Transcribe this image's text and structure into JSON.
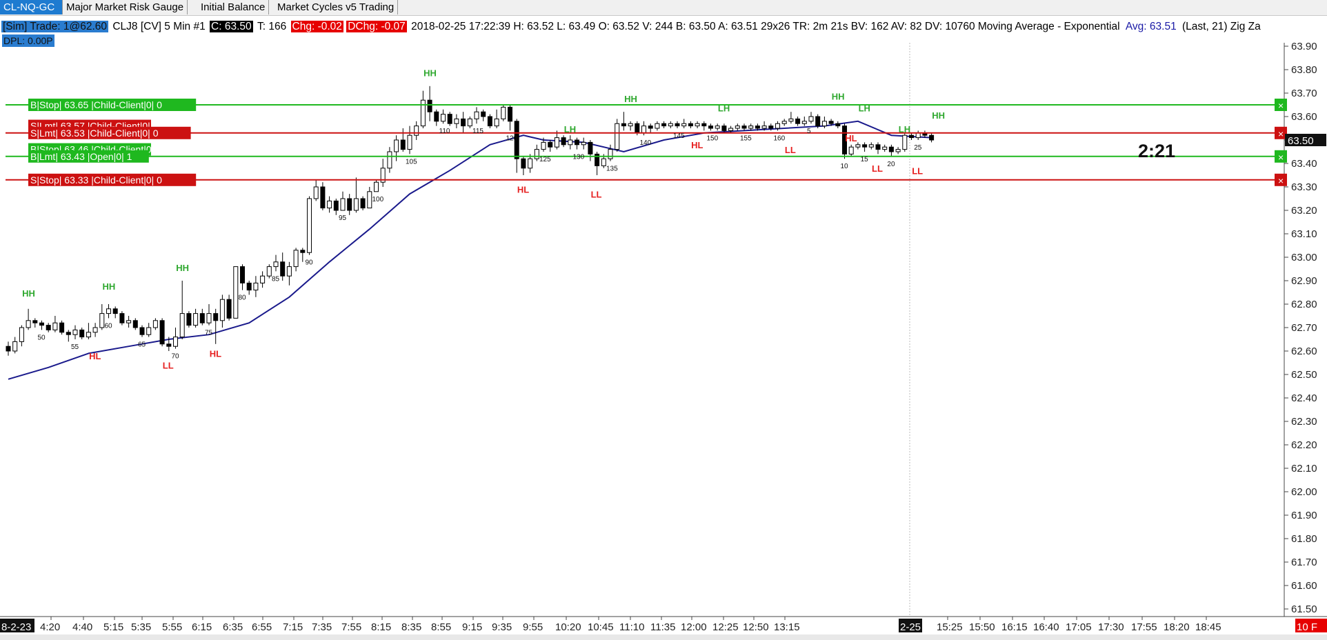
{
  "tabs": [
    {
      "label": "CL-NQ-GC",
      "active": true
    },
    {
      "label": "Major Market Risk Gauge",
      "active": false
    },
    {
      "label": "Initial Balance",
      "active": false
    },
    {
      "label": "Market Cycles v5 Trading",
      "active": false
    }
  ],
  "info": {
    "sim": "[Sim]  Trade: 1@62.60",
    "symbol": "CLJ8 [CV]  5 Min  #1",
    "close": "C: 63.50",
    "ticks": "T: 166",
    "chg": "Chg: -0.02",
    "dchg": "DChg: -0.07",
    "stats": "2018-02-25 17:22:39 H: 63.52 L: 63.49 O: 63.52 V: 244 B: 63.50 A: 63.51 29x26 TR: 2m 21s BV: 162 AV: 82 DV: 10760 Moving Average - Exponential",
    "avg": "Avg: 63.51",
    "last": "(Last, 21)  Zig Za",
    "dpl": "DPL: 0.00P"
  },
  "timer": "2:21",
  "chart_data": {
    "type": "candlestick",
    "symbol": "CLJ8",
    "interval": "5 Min",
    "ylim": [
      61.5,
      63.95
    ],
    "y_ticks": [
      "63.90",
      "63.80",
      "63.70",
      "63.60",
      "63.50",
      "63.40",
      "63.30",
      "63.20",
      "63.10",
      "63.00",
      "62.90",
      "62.80",
      "62.70",
      "62.60",
      "62.50",
      "62.40",
      "62.30",
      "62.20",
      "62.10",
      "62.00",
      "61.90",
      "61.80",
      "61.70",
      "61.60",
      "61.50"
    ],
    "x_ticks": [
      "8-2-23",
      "4:20",
      "4:40",
      "5:15",
      "5:35",
      "5:55",
      "6:15",
      "6:35",
      "6:55",
      "7:15",
      "7:35",
      "7:55",
      "8:15",
      "8:35",
      "8:55",
      "9:15",
      "9:35",
      "9:55",
      "10:20",
      "10:45",
      "11:10",
      "11:35",
      "12:00",
      "12:25",
      "12:50",
      "13:15",
      "2-25",
      "15:25",
      "15:50",
      "16:15",
      "16:40",
      "17:05",
      "17:30",
      "17:55",
      "18:20",
      "18:45",
      "10 F"
    ],
    "last_price_label": "63.50",
    "candles": [
      [
        62.62,
        62.6,
        62.64,
        62.58
      ],
      [
        62.6,
        62.64,
        62.66,
        62.59
      ],
      [
        62.64,
        62.7,
        62.71,
        62.62
      ],
      [
        62.7,
        62.73,
        62.78,
        62.69
      ],
      [
        62.73,
        62.72,
        62.74,
        62.7
      ],
      [
        62.72,
        62.71,
        62.73,
        62.69
      ],
      [
        62.71,
        62.69,
        62.72,
        62.68
      ],
      [
        62.69,
        62.72,
        62.75,
        62.68
      ],
      [
        62.72,
        62.68,
        62.73,
        62.67
      ],
      [
        62.68,
        62.67,
        62.69,
        62.64
      ],
      [
        62.67,
        62.69,
        62.71,
        62.65
      ],
      [
        62.69,
        62.66,
        62.7,
        62.65
      ],
      [
        62.66,
        62.68,
        62.72,
        62.65
      ],
      [
        62.68,
        62.7,
        62.72,
        62.66
      ],
      [
        62.7,
        62.76,
        62.8,
        62.69
      ],
      [
        62.76,
        62.78,
        62.8,
        62.74
      ],
      [
        62.78,
        62.76,
        62.79,
        62.74
      ],
      [
        62.76,
        62.72,
        62.77,
        62.71
      ],
      [
        62.72,
        62.73,
        62.75,
        62.7
      ],
      [
        62.73,
        62.7,
        62.74,
        62.69
      ],
      [
        62.7,
        62.67,
        62.71,
        62.66
      ],
      [
        62.67,
        62.7,
        62.72,
        62.66
      ],
      [
        62.7,
        62.73,
        62.74,
        62.69
      ],
      [
        62.73,
        62.63,
        62.74,
        62.62
      ],
      [
        62.63,
        62.62,
        62.66,
        62.6
      ],
      [
        62.62,
        62.66,
        62.7,
        62.61
      ],
      [
        62.66,
        62.76,
        62.9,
        62.65
      ],
      [
        62.76,
        62.71,
        62.77,
        62.7
      ],
      [
        62.71,
        62.76,
        62.78,
        62.7
      ],
      [
        62.76,
        62.72,
        62.78,
        62.71
      ],
      [
        62.72,
        62.76,
        62.8,
        62.71
      ],
      [
        62.76,
        62.73,
        62.78,
        62.63
      ],
      [
        62.73,
        62.82,
        62.84,
        62.7
      ],
      [
        62.82,
        62.74,
        62.84,
        62.73
      ],
      [
        62.74,
        62.96,
        62.96,
        62.74
      ],
      [
        62.96,
        62.89,
        62.97,
        62.86
      ],
      [
        62.89,
        62.86,
        62.9,
        62.84
      ],
      [
        62.86,
        62.89,
        62.92,
        62.83
      ],
      [
        62.89,
        62.92,
        62.94,
        62.87
      ],
      [
        62.92,
        62.96,
        62.97,
        62.91
      ],
      [
        62.96,
        62.98,
        63.01,
        62.94
      ],
      [
        62.98,
        62.92,
        63.02,
        62.9
      ],
      [
        62.92,
        62.96,
        62.98,
        62.88
      ],
      [
        62.96,
        63.03,
        63.04,
        62.94
      ],
      [
        63.03,
        63.02,
        63.04,
        62.98
      ],
      [
        63.02,
        63.25,
        63.26,
        63.01
      ],
      [
        63.25,
        63.3,
        63.33,
        63.24
      ],
      [
        63.3,
        63.21,
        63.32,
        63.2
      ],
      [
        63.21,
        63.24,
        63.26,
        63.19
      ],
      [
        63.24,
        63.2,
        63.25,
        63.18
      ],
      [
        63.2,
        63.25,
        63.28,
        63.2
      ],
      [
        63.25,
        63.2,
        63.27,
        63.18
      ],
      [
        63.2,
        63.25,
        63.34,
        63.19
      ],
      [
        63.25,
        63.21,
        63.26,
        63.2
      ],
      [
        63.21,
        63.28,
        63.3,
        63.21
      ],
      [
        63.28,
        63.32,
        63.33,
        63.28
      ],
      [
        63.32,
        63.38,
        63.42,
        63.3
      ],
      [
        63.38,
        63.45,
        63.47,
        63.36
      ],
      [
        63.45,
        63.5,
        63.52,
        63.41
      ],
      [
        63.5,
        63.46,
        63.55,
        63.45
      ],
      [
        63.46,
        63.52,
        63.56,
        63.44
      ],
      [
        63.52,
        63.56,
        63.58,
        63.5
      ],
      [
        63.56,
        63.67,
        63.71,
        63.55
      ],
      [
        63.67,
        63.62,
        63.73,
        63.58
      ],
      [
        63.62,
        63.58,
        63.63,
        63.56
      ],
      [
        63.58,
        63.61,
        63.63,
        63.57
      ],
      [
        63.61,
        63.57,
        63.62,
        63.56
      ],
      [
        63.57,
        63.59,
        63.61,
        63.55
      ],
      [
        63.59,
        63.56,
        63.62,
        63.53
      ],
      [
        63.56,
        63.59,
        63.6,
        63.55
      ],
      [
        63.59,
        63.62,
        63.64,
        63.57
      ],
      [
        63.62,
        63.6,
        63.63,
        63.58
      ],
      [
        63.6,
        63.56,
        63.61,
        63.55
      ],
      [
        63.56,
        63.59,
        63.63,
        63.55
      ],
      [
        63.59,
        63.64,
        63.65,
        63.58
      ],
      [
        63.64,
        63.58,
        63.65,
        63.54
      ],
      [
        63.58,
        63.42,
        63.59,
        63.36
      ],
      [
        63.42,
        63.38,
        63.43,
        63.35
      ],
      [
        63.38,
        63.42,
        63.44,
        63.36
      ],
      [
        63.42,
        63.46,
        63.48,
        63.41
      ],
      [
        63.46,
        63.49,
        63.51,
        63.45
      ],
      [
        63.49,
        63.47,
        63.5,
        63.45
      ],
      [
        63.47,
        63.51,
        63.54,
        63.46
      ],
      [
        63.51,
        63.48,
        63.52,
        63.47
      ],
      [
        63.48,
        63.5,
        63.52,
        63.46
      ],
      [
        63.5,
        63.48,
        63.51,
        63.46
      ],
      [
        63.48,
        63.49,
        63.51,
        63.46
      ],
      [
        63.49,
        63.44,
        63.5,
        63.41
      ],
      [
        63.44,
        63.39,
        63.45,
        63.35
      ],
      [
        63.39,
        63.42,
        63.44,
        63.38
      ],
      [
        63.42,
        63.46,
        63.48,
        63.41
      ],
      [
        63.46,
        63.57,
        63.59,
        63.45
      ],
      [
        63.57,
        63.56,
        63.62,
        63.54
      ],
      [
        63.56,
        63.57,
        63.58,
        63.54
      ],
      [
        63.57,
        63.53,
        63.58,
        63.52
      ],
      [
        63.53,
        63.56,
        63.58,
        63.52
      ],
      [
        63.56,
        63.55,
        63.57,
        63.53
      ],
      [
        63.55,
        63.57,
        63.58,
        63.54
      ],
      [
        63.57,
        63.56,
        63.58,
        63.55
      ],
      [
        63.56,
        63.57,
        63.58,
        63.55
      ],
      [
        63.57,
        63.56,
        63.58,
        63.55
      ],
      [
        63.56,
        63.57,
        63.59,
        63.55
      ],
      [
        63.57,
        63.56,
        63.58,
        63.55
      ],
      [
        63.56,
        63.57,
        63.58,
        63.55
      ],
      [
        63.57,
        63.56,
        63.58,
        63.54
      ],
      [
        63.56,
        63.55,
        63.57,
        63.54
      ],
      [
        63.55,
        63.56,
        63.57,
        63.54
      ],
      [
        63.56,
        63.54,
        63.57,
        63.53
      ],
      [
        63.54,
        63.55,
        63.56,
        63.53
      ],
      [
        63.55,
        63.56,
        63.57,
        63.54
      ],
      [
        63.56,
        63.55,
        63.57,
        63.54
      ],
      [
        63.55,
        63.56,
        63.57,
        63.54
      ],
      [
        63.56,
        63.55,
        63.57,
        63.54
      ],
      [
        63.55,
        63.56,
        63.58,
        63.54
      ],
      [
        63.56,
        63.55,
        63.57,
        63.54
      ],
      [
        63.55,
        63.57,
        63.58,
        63.54
      ],
      [
        63.57,
        63.58,
        63.59,
        63.56
      ],
      [
        63.58,
        63.59,
        63.62,
        63.57
      ],
      [
        63.59,
        63.57,
        63.6,
        63.56
      ],
      [
        63.57,
        63.58,
        63.6,
        63.56
      ],
      [
        63.58,
        63.6,
        63.62,
        63.57
      ],
      [
        63.6,
        63.56,
        63.61,
        63.55
      ],
      [
        63.56,
        63.58,
        63.6,
        63.55
      ],
      [
        63.58,
        63.57,
        63.59,
        63.56
      ],
      [
        63.57,
        63.56,
        63.58,
        63.55
      ],
      [
        63.56,
        63.44,
        63.57,
        63.42
      ],
      [
        63.44,
        63.47,
        63.48,
        63.43
      ],
      [
        63.47,
        63.48,
        63.49,
        63.46
      ],
      [
        63.48,
        63.47,
        63.49,
        63.45
      ],
      [
        63.47,
        63.48,
        63.49,
        63.46
      ],
      [
        63.48,
        63.46,
        63.49,
        63.44
      ],
      [
        63.46,
        63.47,
        63.48,
        63.45
      ],
      [
        63.47,
        63.45,
        63.48,
        63.43
      ],
      [
        63.45,
        63.46,
        63.47,
        63.44
      ],
      [
        63.46,
        63.52,
        63.53,
        63.45
      ],
      [
        63.52,
        63.51,
        63.53,
        63.5
      ],
      [
        63.51,
        63.53,
        63.54,
        63.5
      ],
      [
        63.53,
        63.52,
        63.54,
        63.51
      ],
      [
        63.52,
        63.5,
        63.53,
        63.49
      ]
    ],
    "ema": [
      [
        0,
        62.48
      ],
      [
        6,
        62.53
      ],
      [
        12,
        62.59
      ],
      [
        18,
        62.62
      ],
      [
        24,
        62.65
      ],
      [
        30,
        62.67
      ],
      [
        36,
        62.72
      ],
      [
        42,
        62.83
      ],
      [
        48,
        62.98
      ],
      [
        54,
        63.12
      ],
      [
        60,
        63.27
      ],
      [
        66,
        63.37
      ],
      [
        72,
        63.48
      ],
      [
        77,
        63.52
      ],
      [
        80,
        63.5
      ],
      [
        86,
        63.49
      ],
      [
        92,
        63.45
      ],
      [
        98,
        63.5
      ],
      [
        104,
        63.53
      ],
      [
        110,
        63.54
      ],
      [
        116,
        63.55
      ],
      [
        122,
        63.56
      ],
      [
        127,
        63.58
      ],
      [
        132,
        63.52
      ],
      [
        138,
        63.51
      ]
    ],
    "swings": [
      {
        "text": "HH",
        "price": 62.82,
        "i": 3,
        "kind": "high",
        "color": "#2fa82f"
      },
      {
        "text": "HH",
        "price": 62.85,
        "i": 15,
        "kind": "high",
        "color": "#2fa82f"
      },
      {
        "text": "HL",
        "price": 62.6,
        "i": 13,
        "kind": "low",
        "color": "#e62020"
      },
      {
        "text": "HH",
        "price": 62.93,
        "i": 26,
        "kind": "high",
        "color": "#2fa82f"
      },
      {
        "text": "LL",
        "price": 62.56,
        "i": 24,
        "kind": "low",
        "color": "#e62020"
      },
      {
        "text": "HL",
        "price": 62.61,
        "i": 31,
        "kind": "low",
        "color": "#e62020"
      },
      {
        "text": "HH",
        "price": 63.76,
        "i": 63,
        "kind": "high",
        "color": "#2fa82f"
      },
      {
        "text": "HL",
        "price": 63.31,
        "i": 77,
        "kind": "low",
        "color": "#e62020"
      },
      {
        "text": "LH",
        "price": 63.52,
        "i": 84,
        "kind": "high",
        "color": "#2fa82f"
      },
      {
        "text": "LL",
        "price": 63.29,
        "i": 88,
        "kind": "low",
        "color": "#e62020"
      },
      {
        "text": "HH",
        "price": 63.65,
        "i": 93,
        "kind": "high",
        "color": "#2fa82f"
      },
      {
        "text": "HL",
        "price": 63.5,
        "i": 103,
        "kind": "low",
        "color": "#e62020"
      },
      {
        "text": "LH",
        "price": 63.61,
        "i": 107,
        "kind": "high",
        "color": "#2fa82f"
      },
      {
        "text": "LL",
        "price": 63.48,
        "i": 117,
        "kind": "low",
        "color": "#e62020"
      },
      {
        "text": "HH",
        "price": 63.66,
        "i": 124,
        "kind": "high",
        "color": "#2fa82f"
      },
      {
        "text": "HL",
        "price": 63.53,
        "i": 126,
        "kind": "low",
        "color": "#e62020"
      },
      {
        "text": "LH",
        "price": 63.61,
        "i": 128,
        "kind": "high",
        "color": "#2fa82f"
      },
      {
        "text": "LL",
        "price": 63.4,
        "i": 130,
        "kind": "low",
        "color": "#e62020"
      },
      {
        "text": "LH",
        "price": 63.52,
        "i": 134,
        "kind": "high",
        "color": "#2fa82f"
      },
      {
        "text": "LL",
        "price": 63.39,
        "i": 136,
        "kind": "low",
        "color": "#e62020"
      },
      {
        "text": "HH",
        "price": 63.58,
        "i": 139,
        "kind": "high",
        "color": "#2fa82f"
      }
    ],
    "bar_counts": [
      {
        "text": "50",
        "i": 5
      },
      {
        "text": "55",
        "i": 10
      },
      {
        "text": "60",
        "i": 15
      },
      {
        "text": "65",
        "i": 20
      },
      {
        "text": "70",
        "i": 25
      },
      {
        "text": "75",
        "i": 30
      },
      {
        "text": "80",
        "i": 35
      },
      {
        "text": "85",
        "i": 40
      },
      {
        "text": "90",
        "i": 45
      },
      {
        "text": "95",
        "i": 50
      },
      {
        "text": "100",
        "i": 55
      },
      {
        "text": "105",
        "i": 60
      },
      {
        "text": "110",
        "i": 65
      },
      {
        "text": "115",
        "i": 70
      },
      {
        "text": "120",
        "i": 75
      },
      {
        "text": "125",
        "i": 80
      },
      {
        "text": "130",
        "i": 85
      },
      {
        "text": "135",
        "i": 90
      },
      {
        "text": "140",
        "i": 95
      },
      {
        "text": "145",
        "i": 100
      },
      {
        "text": "150",
        "i": 105
      },
      {
        "text": "155",
        "i": 110
      },
      {
        "text": "160",
        "i": 115
      },
      {
        "text": "5",
        "i": 120
      },
      {
        "text": "10",
        "i": 125
      },
      {
        "text": "15",
        "i": 128
      },
      {
        "text": "20",
        "i": 132
      },
      {
        "text": "25",
        "i": 136
      }
    ],
    "orders": [
      {
        "label": "B|Stop| 63.65 |Child-Client|0| 0",
        "price": 63.65,
        "color": "#1fb81f"
      },
      {
        "label": "S|Lmt| 63.53 |Child-Client|0| 0",
        "price": 63.53,
        "color": "#cc1111"
      },
      {
        "label": "B|Lmt| 63.43 |Open|0| 1",
        "price": 63.43,
        "color": "#1fb81f"
      },
      {
        "label": "S|Stop| 63.33 |Child-Client|0| 0",
        "price": 63.33,
        "color": "#cc1111"
      }
    ],
    "stop_overlap_labels": [
      {
        "label": "S|Lmt| 63.57 |Child-Client|0| 0",
        "price": 63.56,
        "color": "#cc1111"
      },
      {
        "label": "B|Stop| 63.46 |Child-Client|0| 0",
        "price": 63.46,
        "color": "#1fb81f"
      }
    ]
  }
}
